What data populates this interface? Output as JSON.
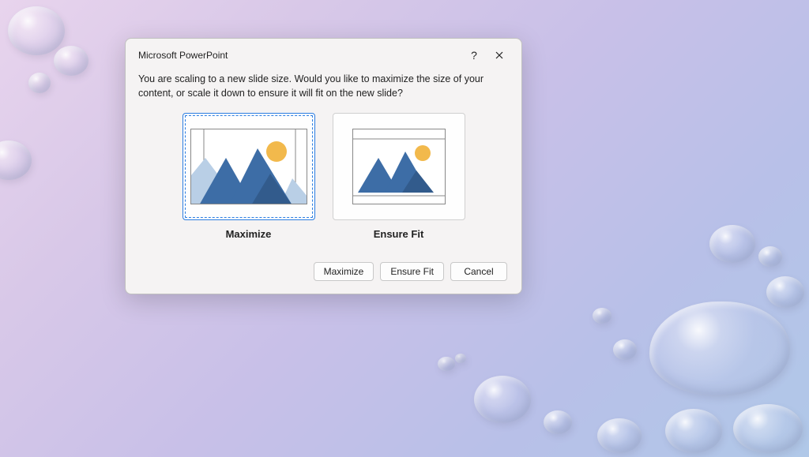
{
  "dialog": {
    "title": "Microsoft PowerPoint",
    "message": "You are scaling to a new slide size.  Would you like to maximize the size of your content, or scale it down to ensure it will fit on the new slide?",
    "options": {
      "maximize": {
        "label": "Maximize",
        "selected": true
      },
      "ensureFit": {
        "label": "Ensure Fit",
        "selected": false
      }
    },
    "buttons": {
      "maximize": "Maximize",
      "ensureFit": "Ensure Fit",
      "cancel": "Cancel"
    },
    "titlebar": {
      "help": "?",
      "close": "✕"
    }
  }
}
